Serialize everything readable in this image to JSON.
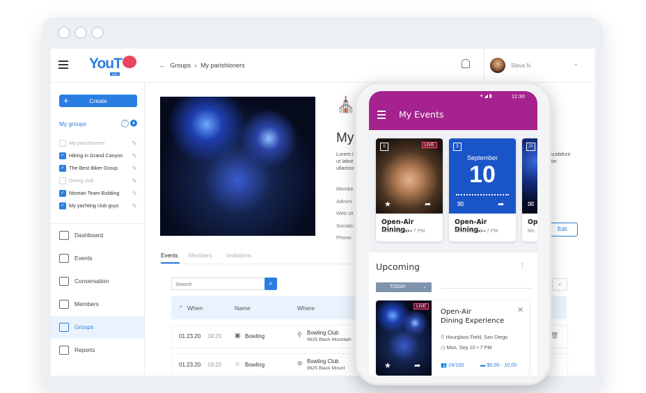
{
  "app": {
    "logo_text": "YouT",
    "logo_sub": "beta"
  },
  "breadcrumb": {
    "back": "←",
    "items": [
      "Groups",
      "My parishioners"
    ],
    "sep": "‹"
  },
  "user": {
    "name": "Slava N."
  },
  "sidebar": {
    "create_label": "Create",
    "my_groups_label": "My groups",
    "groups": [
      {
        "label": "My parishioners",
        "checked": false
      },
      {
        "label": "Hiking in Grand Canyon",
        "checked": true
      },
      {
        "label": "The Best Biker Group",
        "checked": true
      },
      {
        "label": "Diving club",
        "checked": false
      },
      {
        "label": "Nisman Team Building",
        "checked": true
      },
      {
        "label": "My yachting club guys",
        "checked": true
      }
    ],
    "nav": [
      {
        "label": "Dashboard",
        "icon": "dashboard-icon"
      },
      {
        "label": "Events",
        "icon": "calendar-icon"
      },
      {
        "label": "Conversation",
        "icon": "chat-icon"
      },
      {
        "label": "Members",
        "icon": "members-icon"
      },
      {
        "label": "Groups",
        "icon": "groups-icon",
        "active": true
      },
      {
        "label": "Reports",
        "icon": "reports-icon"
      }
    ]
  },
  "group": {
    "title": "My",
    "desc_lines": [
      "Lorem i",
      "ut labor",
      "ullamco"
    ],
    "desc_right": [
      "incididunt",
      "tion"
    ],
    "fields": [
      "Membe",
      "Admini",
      "Web sit",
      "Socials:",
      "Phone:"
    ],
    "edit_label": "Edit"
  },
  "tabs": [
    "Events",
    "Members",
    "Invitations"
  ],
  "search": {
    "placeholder": "Search"
  },
  "table": {
    "headers": [
      "When",
      "Name",
      "Where"
    ],
    "rows": [
      {
        "date": "01.23.20",
        "time": "19:20",
        "name": "Bowling",
        "where": "Bowling Club",
        "address": "9625 Black Mountain"
      },
      {
        "date": "01.23.20",
        "time": "19:20",
        "name": "Bowling",
        "where": "Bowling Club",
        "address": "9625 Black Mount"
      }
    ]
  },
  "phone": {
    "status_time": "12:30",
    "title": "My Events",
    "cards": [
      {
        "day": "0",
        "badge": "LIVE",
        "title": "Open-Air Dining...",
        "sub": "Mon, Sep 10 • 7 PM"
      },
      {
        "day": "5",
        "month": "September",
        "date": "10",
        "title": "Open-Air Dining...",
        "sub": "Mon, Sep 10 • 7 PM"
      },
      {
        "day": "20",
        "title": "Op",
        "sub": "Mo"
      }
    ],
    "upcoming_label": "Upcoming",
    "today_label": "TODAY",
    "event": {
      "badge": "LIVE",
      "title_line1": "Open-Air",
      "title_line2": "Dining Experience",
      "place": "Hourglass Field, San Diego",
      "time": "Mon, Sep 10 • 7 PM",
      "members": "24/100",
      "price": "$0.00 - 10.00"
    }
  },
  "colors": {
    "accent": "#2a7de1",
    "phone_header": "#a5228f",
    "ticket": "#1a55c8"
  }
}
